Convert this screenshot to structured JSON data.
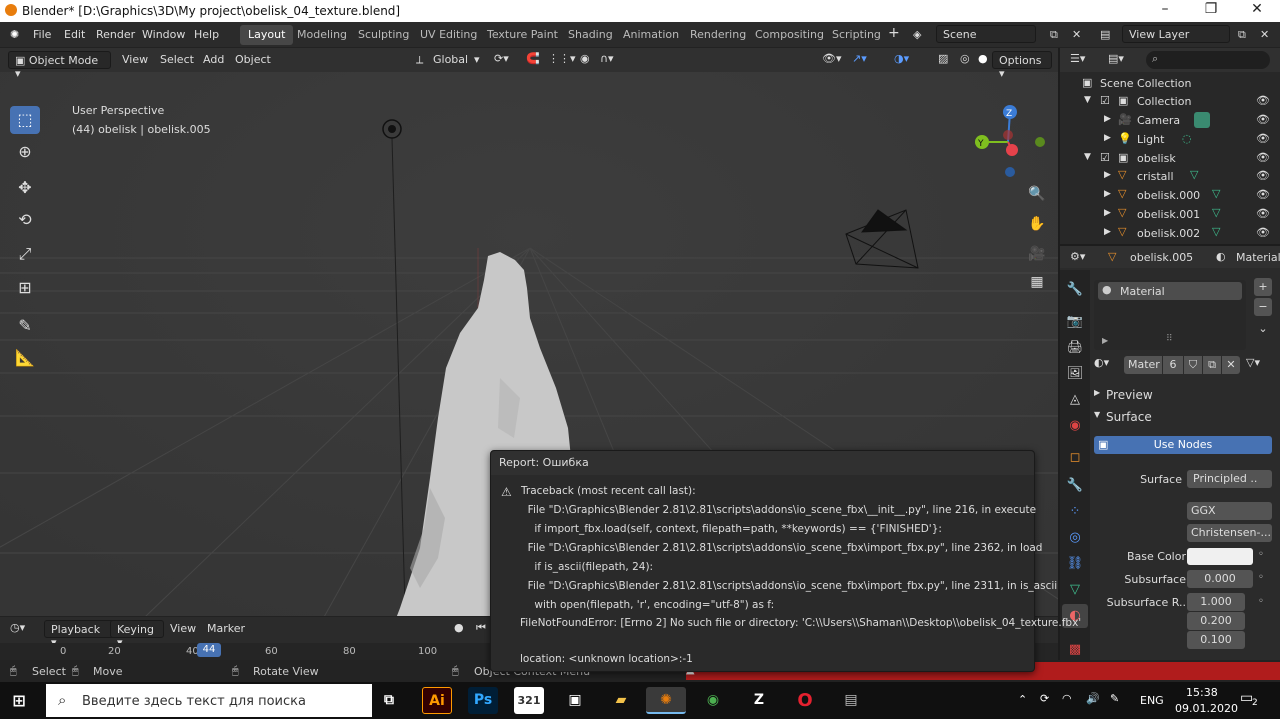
{
  "window": {
    "title": "Blender* [D:\\Graphics\\3D\\My project\\obelisk_04_texture.blend]"
  },
  "menus": [
    "File",
    "Edit",
    "Render",
    "Window",
    "Help"
  ],
  "workspaces": [
    "Layout",
    "Modeling",
    "Sculpting",
    "UV Editing",
    "Texture Paint",
    "Shading",
    "Animation",
    "Rendering",
    "Compositing",
    "Scripting"
  ],
  "scene": {
    "name": "Scene",
    "view_layer": "View Layer"
  },
  "viewport": {
    "mode": "Object Mode",
    "menus": [
      "View",
      "Select",
      "Add",
      "Object"
    ],
    "transform_orientation": "Global",
    "options_label": "Options",
    "perspective_label": "User Perspective",
    "object_info": "(44) obelisk | obelisk.005"
  },
  "outliner": {
    "root": "Scene Collection",
    "items": [
      {
        "label": "Collection"
      },
      {
        "label": "Camera"
      },
      {
        "label": "Light"
      },
      {
        "label": "obelisk"
      },
      {
        "label": "cristall"
      },
      {
        "label": "obelisk.000"
      },
      {
        "label": "obelisk.001"
      },
      {
        "label": "obelisk.002"
      }
    ]
  },
  "properties": {
    "object_name": "obelisk.005",
    "context_label": "Material",
    "slot_name": "Material",
    "material_name": "Mater",
    "user_count": "6",
    "sections": {
      "preview": "Preview",
      "surface": "Surface"
    },
    "use_nodes_label": "Use Nodes",
    "surface_label": "Surface",
    "surface_value": "Principled ..",
    "distribution": "GGX",
    "subsurface_method": "Christensen-...",
    "base_color_label": "Base Color",
    "base_color": "#f0f0f0",
    "subsurface_label": "Subsurface",
    "subsurface_value": "0.000",
    "subsurface_r_label": "Subsurface R..",
    "subsurface_r": [
      "1.000",
      "0.200",
      "0.100"
    ]
  },
  "timeline": {
    "menus": [
      "Playback",
      "Keying",
      "View",
      "Marker"
    ],
    "ticks": [
      "0",
      "20",
      "40",
      "60",
      "80",
      "100"
    ],
    "current_frame": "44"
  },
  "status": {
    "select": "Select",
    "move": "Move",
    "rotate": "Rotate View",
    "context": "Object Context Menu"
  },
  "report": {
    "title": "Report: Ошибка",
    "lines": [
      "Traceback (most recent call last):",
      "  File \"D:\\Graphics\\Blender 2.81\\2.81\\scripts\\addons\\io_scene_fbx\\__init__.py\", line 216, in execute",
      "    if import_fbx.load(self, context, filepath=path, **keywords) == {'FINISHED'}:",
      "  File \"D:\\Graphics\\Blender 2.81\\2.81\\scripts\\addons\\io_scene_fbx\\import_fbx.py\", line 2362, in load",
      "    if is_ascii(filepath, 24):",
      "  File \"D:\\Graphics\\Blender 2.81\\2.81\\scripts\\addons\\io_scene_fbx\\import_fbx.py\", line 2311, in is_ascii",
      "    with open(filepath, 'r', encoding=\"utf-8\") as f:",
      "FileNotFoundError: [Errno 2] No such file or directory: 'C:\\\\Users\\\\Shaman\\\\Desktop\\\\obelisk_04_texture.fbx'",
      "",
      "location: <unknown location>:-1"
    ]
  },
  "taskbar": {
    "search_placeholder": "Введите здесь текст для поиска",
    "lang": "ENG",
    "time": "15:38",
    "date": "09.01.2020",
    "notifications": "2"
  }
}
